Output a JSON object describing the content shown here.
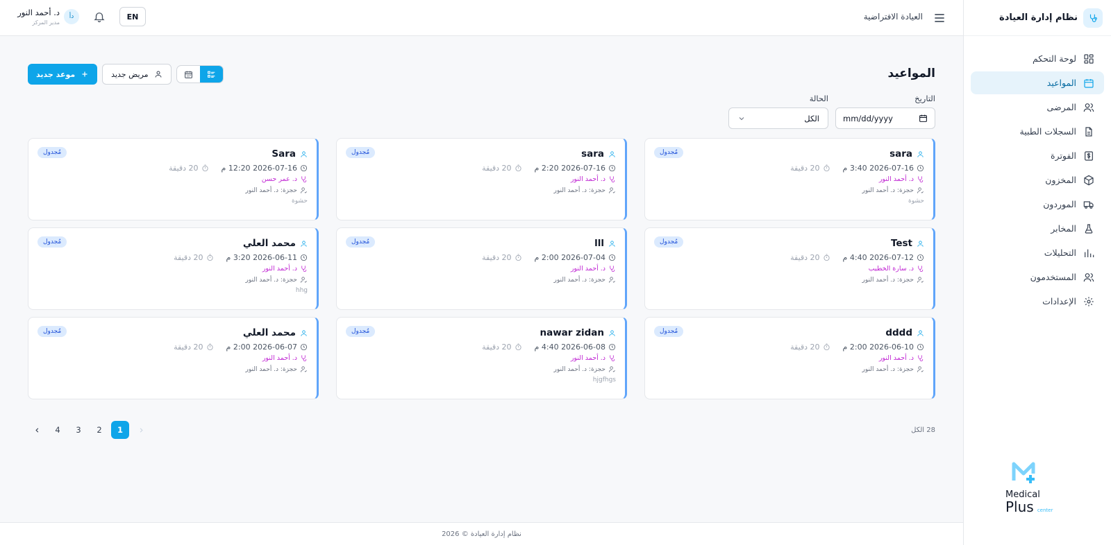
{
  "sidebar": {
    "brand_title": "نظام إدارة العيادة",
    "items": [
      {
        "label": "لوحة التحكم",
        "icon": "dashboard-icon"
      },
      {
        "label": "المواعيد",
        "icon": "calendar-icon",
        "active": true
      },
      {
        "label": "المرضى",
        "icon": "users-icon"
      },
      {
        "label": "السجلات الطبية",
        "icon": "file-icon"
      },
      {
        "label": "الفوترة",
        "icon": "dollar-icon"
      },
      {
        "label": "المخزون",
        "icon": "box-icon"
      },
      {
        "label": "الموردون",
        "icon": "truck-icon"
      },
      {
        "label": "المخابر",
        "icon": "flask-icon"
      },
      {
        "label": "التحليلات",
        "icon": "bar-chart-icon"
      },
      {
        "label": "المستخدمون",
        "icon": "user-group-icon"
      },
      {
        "label": "الإعدادات",
        "icon": "gear-icon"
      }
    ],
    "logo": {
      "word1": "Medical",
      "word2": "Plus",
      "word3": "center"
    }
  },
  "header": {
    "clinic_name": "العيادة الافتراضية",
    "lang_label": "EN",
    "user_name": "د. أحمد النور",
    "user_role": "مدير المركز",
    "user_initials": "دأ"
  },
  "main": {
    "title": "المواعيد",
    "new_appointment_label": "موعد جديد",
    "new_patient_label": "مريض جديد",
    "filters": {
      "date_label": "التاريخ",
      "date_placeholder": "mm/dd/yyyy",
      "status_label": "الحالة",
      "status_value": "الكل"
    },
    "appointments": [
      {
        "patient": "sara",
        "datetime": "2026-07-16 3:40 م",
        "duration": "20 دقيقة",
        "doctor": "د. أحمد النور",
        "booked_by": "حجزة: د. أحمد النور",
        "note": "حشوة",
        "status": "مُجدول"
      },
      {
        "patient": "sara",
        "datetime": "2026-07-16 2:20 م",
        "duration": "20 دقيقة",
        "doctor": "د. أحمد النور",
        "booked_by": "حجزة: د. أحمد النور",
        "note": "",
        "status": "مُجدول"
      },
      {
        "patient": "Sara",
        "datetime": "2026-07-16 12:20 م",
        "duration": "20 دقيقة",
        "doctor": "د. عمر حسن",
        "booked_by": "حجزة: د. أحمد النور",
        "note": "حشوة",
        "status": "مُجدول"
      },
      {
        "patient": "Test",
        "datetime": "2026-07-12 4:40 م",
        "duration": "20 دقيقة",
        "doctor": "د. سارة الخطيب",
        "booked_by": "حجزة: د. أحمد النور",
        "note": "",
        "status": "مُجدول"
      },
      {
        "patient": "lll",
        "datetime": "2026-07-04 2:00 م",
        "duration": "20 دقيقة",
        "doctor": "د. أحمد النور",
        "booked_by": "حجزة: د. أحمد النور",
        "note": "",
        "status": "مُجدول"
      },
      {
        "patient": "محمد العلي",
        "datetime": "2026-06-11 3:20 م",
        "duration": "20 دقيقة",
        "doctor": "د. أحمد النور",
        "booked_by": "حجزة: د. أحمد النور",
        "note": "hhg",
        "status": "مُجدول"
      },
      {
        "patient": "dddd",
        "datetime": "2026-06-10 2:00 م",
        "duration": "20 دقيقة",
        "doctor": "د. أحمد النور",
        "booked_by": "حجزة: د. أحمد النور",
        "note": "",
        "status": "مُجدول"
      },
      {
        "patient": "nawar zidan",
        "datetime": "2026-06-08 4:40 م",
        "duration": "20 دقيقة",
        "doctor": "د. أحمد النور",
        "booked_by": "حجزة: د. أحمد النور",
        "note": "hjgfhgs",
        "status": "مُجدول"
      },
      {
        "patient": "محمد العلي",
        "datetime": "2026-06-07 2:00 م",
        "duration": "20 دقيقة",
        "doctor": "د. أحمد النور",
        "booked_by": "حجزة: د. أحمد النور",
        "note": "",
        "status": "مُجدول"
      }
    ],
    "pagination": {
      "total": "28 الكل",
      "pages": [
        "1",
        "2",
        "3",
        "4"
      ],
      "current": "1"
    }
  },
  "footer": {
    "text": "نظام إدارة العيادة © 2026"
  },
  "colors": {
    "accent": "#0ea5e9",
    "card_border": "#60a5fa",
    "doctor": "#c026d3",
    "badge_bg": "#dbeafe"
  }
}
